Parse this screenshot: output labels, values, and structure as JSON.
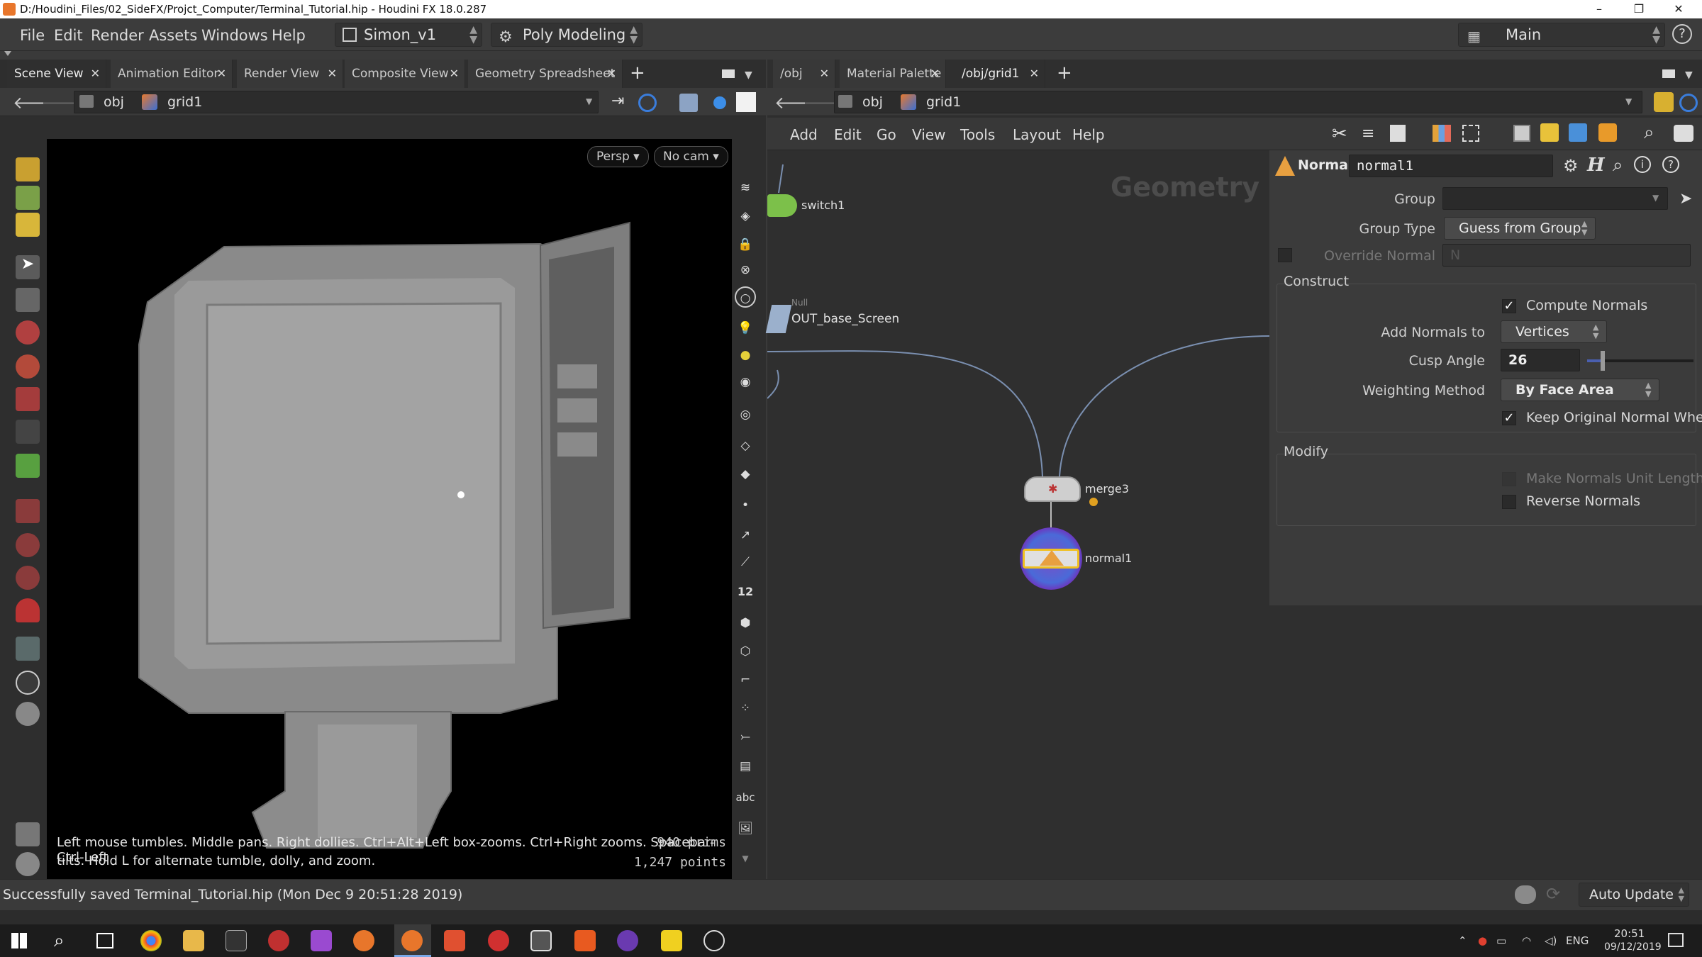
{
  "titlebar": {
    "title": "D:/Houdini_Files/02_SideFX/Projct_Computer/Terminal_Tutorial.hip - Houdini FX 18.0.287",
    "minimize": "–",
    "maximize": "❐",
    "close": "✕"
  },
  "menu": {
    "items": [
      "File",
      "Edit",
      "Render",
      "Assets",
      "Windows",
      "Help"
    ],
    "desktop": "Simon_v1",
    "shelf": "Poly Modeling",
    "main": "Main",
    "help": "?"
  },
  "left_pane": {
    "tabs": [
      "Scene View",
      "Animation Editor",
      "Render View",
      "Composite View",
      "Geometry Spreadsheet"
    ],
    "add_tab": "+",
    "path": {
      "root": "obj",
      "node": "grid1"
    },
    "viewport": {
      "persp": "Persp ▾",
      "cam": "No cam ▾",
      "hint_line1": "Left mouse tumbles. Middle pans. Right dollies. Ctrl+Alt+Left box-zooms. Ctrl+Right zooms. Spacebar-Ctrl-Left",
      "hint_line2": "tilts. Hold L for alternate tumble, dolly, and zoom.",
      "prims": "940  prims",
      "points": "1,247 points"
    },
    "right_tools": {
      "twelve": "12",
      "abc": "abc"
    }
  },
  "right_pane": {
    "tabs": [
      "/obj",
      "Material Palette",
      "/obj/grid1"
    ],
    "add_tab": "+",
    "path": {
      "root": "obj",
      "node": "grid1"
    },
    "net_menu": [
      "Add",
      "Edit",
      "Go",
      "View",
      "Tools",
      "Layout",
      "Help"
    ],
    "watermark": "Geometry",
    "nodes": {
      "switch": "switch1",
      "null_type": "Null",
      "null": "OUT_base_Screen",
      "merge": "merge3",
      "normal": "normal1"
    },
    "params": {
      "type": "Normal",
      "name": "normal1",
      "group_label": "Group",
      "group_value": "",
      "group_type_label": "Group Type",
      "group_type_value": "Guess from Group",
      "override_label": "Override Normal",
      "override_value": "N",
      "construct_title": "Construct",
      "compute_label": "Compute Normals",
      "add_normals_label": "Add Normals to",
      "add_normals_value": "Vertices",
      "cusp_label": "Cusp Angle",
      "cusp_value": "26",
      "cusp_fraction": 0.144,
      "weighting_label": "Weighting Method",
      "weighting_value": "By Face Area",
      "keep_label": "Keep Original Normal Where Com...",
      "modify_title": "Modify",
      "unit_label": "Make Normals Unit Length",
      "reverse_label": "Reverse Normals"
    }
  },
  "status": {
    "message": "Successfully saved Terminal_Tutorial.hip (Mon Dec  9 20:51:28 2019)",
    "auto_update": "Auto Update"
  },
  "taskbar": {
    "lang": "ENG",
    "time": "20:51",
    "date": "09/12/2019"
  }
}
